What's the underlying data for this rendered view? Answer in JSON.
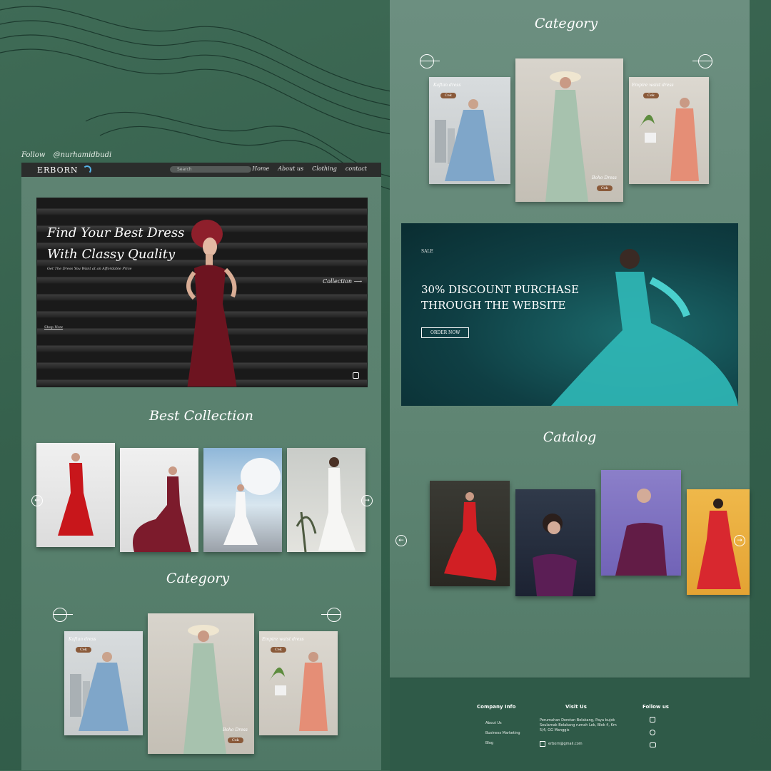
{
  "follow_line": {
    "label": "Follow",
    "handle": "@nurhamidbudi"
  },
  "nav": {
    "brand": "ERBORN",
    "search_placeholder": "Search",
    "links": [
      "Home",
      "About us",
      "Clothing",
      "contact"
    ]
  },
  "hero": {
    "title_line1": "Find Your Best Dress",
    "title_line2": "With Classy Quality",
    "subtitle": "Get The Dress You Want at an Affordable Price",
    "collection_link": "Collection",
    "shop_now": "Shop Now"
  },
  "best_collection": {
    "title": "Best Collection"
  },
  "category": {
    "title": "Category",
    "items": [
      {
        "name": "Kaftan dress",
        "button": "Cek"
      },
      {
        "name": "Boho Dress",
        "button": "Cek"
      },
      {
        "name": "Empire waist dress",
        "button": "Cek"
      }
    ]
  },
  "banner": {
    "tag": "SALE",
    "line1": "30% DISCOUNT PURCHASE",
    "line2": "THROUGH THE WEBSITE",
    "button": "ORDER NOW"
  },
  "catalog": {
    "title": "Catalog"
  },
  "footer": {
    "company_info": {
      "title": "Company Info",
      "links": [
        "About Us",
        "Business Marketing",
        "Blog"
      ]
    },
    "visit_us": {
      "title": "Visit Us",
      "address": "Perumahan Deretan Belakang, Paya bujok Seulamak Belakang rumah Lek, Blok 4, Km 5/4, GG Manggis",
      "email": "erborn@gmail.com"
    },
    "follow_us": {
      "title": "Follow us"
    }
  },
  "colors": {
    "background": "#35604c",
    "navbar": "#2b2d2c",
    "banner_teal": "#1c6a6c",
    "button_brown": "#8a5a3a"
  }
}
